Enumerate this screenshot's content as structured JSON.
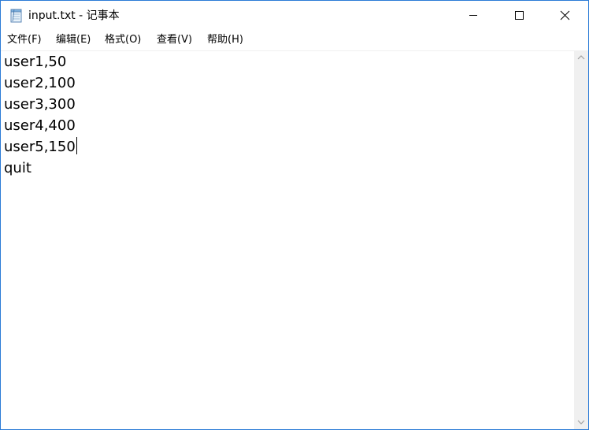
{
  "window": {
    "title": "input.txt - 记事本"
  },
  "menu": {
    "file": "文件(F)",
    "edit": "编辑(E)",
    "format": "格式(O)",
    "view": "查看(V)",
    "help": "帮助(H)"
  },
  "document": {
    "lines": [
      "user1,50",
      "user2,100",
      "user3,300",
      "user4,400",
      "user5,150",
      "quit"
    ]
  },
  "icons": {
    "app": "notepad-icon",
    "minimize": "minimize-icon",
    "maximize": "maximize-icon",
    "close": "close-icon",
    "scroll_up": "chevron-up-icon",
    "scroll_down": "chevron-down-icon"
  },
  "colors": {
    "window_border": "#2b7bd6",
    "scrollbar": "#f0f0f0",
    "text": "#000000"
  }
}
